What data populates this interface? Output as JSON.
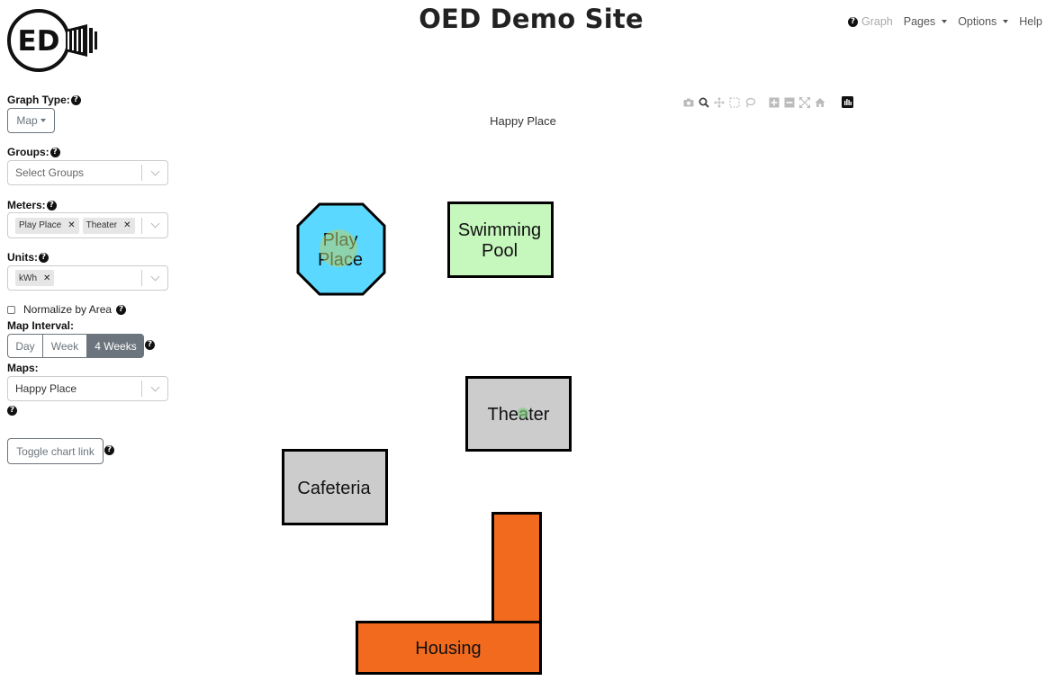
{
  "header": {
    "logo_text": "ED",
    "title": "OED Demo Site",
    "nav": [
      {
        "label": "Graph",
        "icon": "question-circle-icon",
        "disabled": true
      },
      {
        "label": "Pages",
        "dropdown": true
      },
      {
        "label": "Options",
        "dropdown": true
      },
      {
        "label": "Help"
      }
    ]
  },
  "sidebar": {
    "graph_type": {
      "label": "Graph Type:",
      "value": "Map"
    },
    "groups": {
      "label": "Groups:",
      "placeholder": "Select Groups"
    },
    "meters": {
      "label": "Meters:",
      "selected": [
        "Play Place",
        "Theater"
      ]
    },
    "units": {
      "label": "Units:",
      "selected": [
        "kWh"
      ]
    },
    "normalize": {
      "label": "Normalize by Area",
      "checked": false
    },
    "map_interval": {
      "label": "Map Interval:",
      "options": [
        "Day",
        "Week",
        "4 Weeks"
      ],
      "active": "4 Weeks"
    },
    "maps": {
      "label": "Maps:",
      "value": "Happy Place"
    },
    "toggle_chart_link": "Toggle chart link"
  },
  "map": {
    "title": "Happy Place",
    "buildings": [
      {
        "name": "Play Place",
        "lines": [
          "Play",
          "Place"
        ],
        "color": "#5bd8ff"
      },
      {
        "name": "Swimming Pool",
        "lines": [
          "Swimming",
          "Pool"
        ],
        "color": "#c6f7bd"
      },
      {
        "name": "Theater",
        "lines": [
          "Theater"
        ],
        "color": "#cccccc"
      },
      {
        "name": "Cafeteria",
        "lines": [
          "Cafeteria"
        ],
        "color": "#cccccc"
      },
      {
        "name": "Housing",
        "lines": [
          "Housing"
        ],
        "color": "#f26a1e"
      }
    ],
    "markers": [
      {
        "meter": "Play Place",
        "color": "#b5cf6b"
      },
      {
        "meter": "Theater",
        "color": "#7fc97f"
      }
    ]
  },
  "modebar": [
    "camera-icon",
    "zoom-icon",
    "pan-icon",
    "box-select-icon",
    "lasso-select-icon",
    "zoom-in-icon",
    "zoom-out-icon",
    "autoscale-icon",
    "reset-axes-icon",
    "plotly-logo-icon"
  ]
}
